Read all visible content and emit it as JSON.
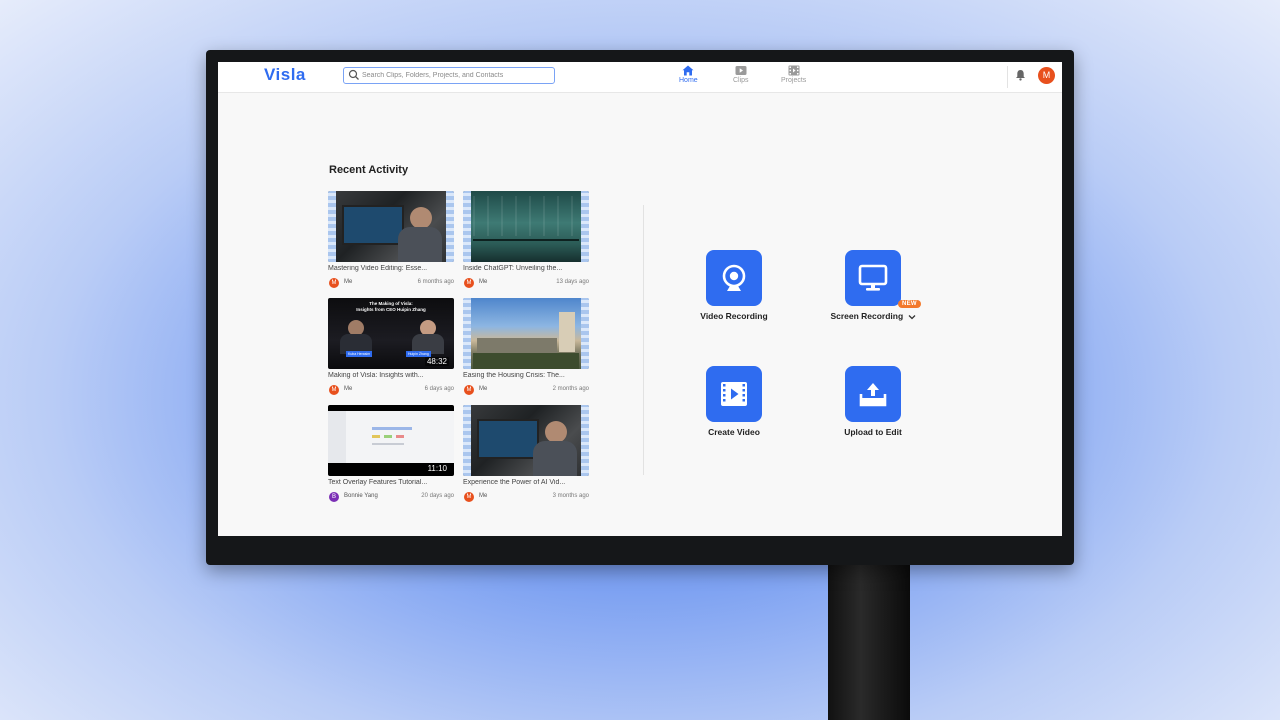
{
  "app": {
    "logo": "Visla",
    "search_placeholder": "Search Clips, Folders, Projects, and Contacts",
    "avatar_initial": "M"
  },
  "nav": {
    "tabs": [
      {
        "label": "Home",
        "icon": "home-icon",
        "active": true
      },
      {
        "label": "Clips",
        "icon": "clips-icon",
        "active": false
      },
      {
        "label": "Projects",
        "icon": "projects-icon",
        "active": false
      }
    ]
  },
  "recent": {
    "title": "Recent Activity",
    "items": [
      {
        "title": "Mastering Video Editing: Esse...",
        "user": "Me",
        "initial": "M",
        "date": "6 months ago",
        "duration": ""
      },
      {
        "title": "Inside ChatGPT: Unveiling the...",
        "user": "Me",
        "initial": "M",
        "date": "13 days ago",
        "duration": ""
      },
      {
        "title": "Making of Visla: Insights with...",
        "user": "Me",
        "initial": "M",
        "date": "6 days ago",
        "duration": "48:32",
        "thumb_text": {
          "heading": "The Making of Visla:\nInsights from CEO Huipin Zhang",
          "left_name": "Kuba Herasim",
          "right_name": "Huipin Zhang"
        }
      },
      {
        "title": "Easing the Housing Crisis: The...",
        "user": "Me",
        "initial": "M",
        "date": "2 months ago",
        "duration": ""
      },
      {
        "title": "Text Overlay Features Tutorial...",
        "user": "Bonnie Yang",
        "initial": "B",
        "date": "20 days ago",
        "duration": "11:10"
      },
      {
        "title": "Experience the Power of AI Vid...",
        "user": "Me",
        "initial": "M",
        "date": "3 months ago",
        "duration": ""
      }
    ]
  },
  "actions": {
    "items": [
      {
        "label": "Video Recording",
        "icon": "webcam-icon"
      },
      {
        "label": "Screen Recording",
        "icon": "monitor-icon",
        "badge": "NEW",
        "has_dropdown": true
      },
      {
        "label": "Create Video",
        "icon": "film-play-icon"
      },
      {
        "label": "Upload to Edit",
        "icon": "upload-icon"
      }
    ]
  },
  "colors": {
    "accent": "#2f6cf0",
    "badge": "#f3792b",
    "avatar_me": "#e8501d",
    "avatar_b": "#7b2fb5"
  }
}
